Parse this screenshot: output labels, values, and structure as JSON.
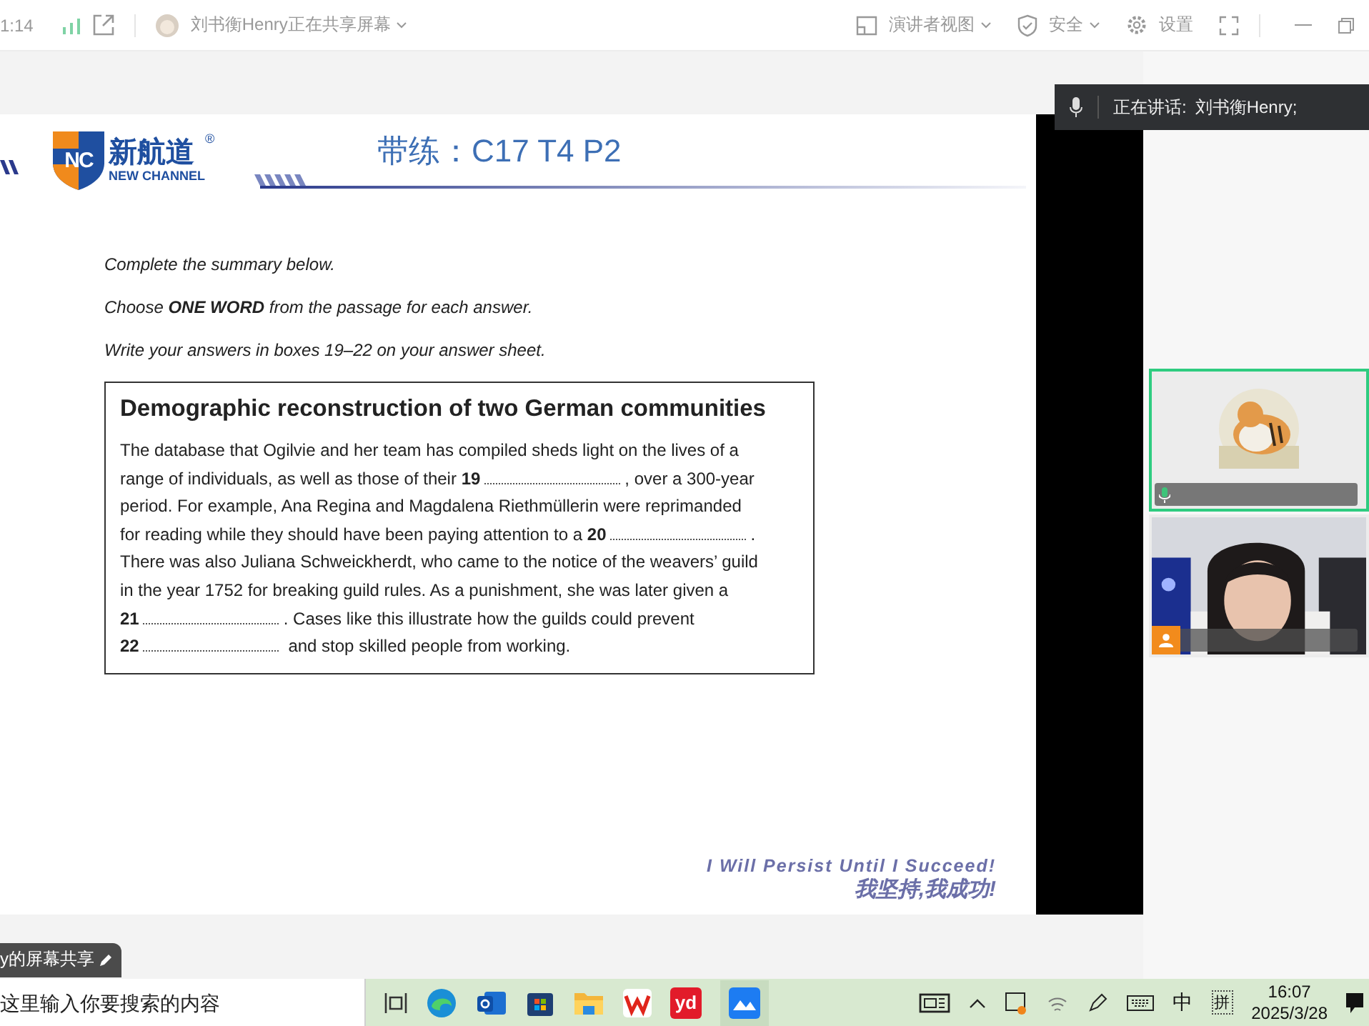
{
  "top_bar": {
    "time": "1:14",
    "sharer": "刘书衡Henry正在共享屏幕",
    "presenter_view": "演讲者视图",
    "security": "安全",
    "settings": "设置"
  },
  "slide": {
    "logo": {
      "mark": "NC",
      "name": "新航道",
      "registered": "®",
      "english": "NEW CHANNEL"
    },
    "title": "带练：C17 T4 P2",
    "instructions": [
      "Complete the summary below.",
      "Choose **ONE WORD** from the passage for each answer.",
      "Write your answers in boxes 19–22 on your answer sheet."
    ],
    "summary": {
      "heading": "Demographic reconstruction of two German communities",
      "lines": [
        [
          {
            "kind": "text",
            "text": "The database that Ogilvie and her team has compiled sheds light on the lives of a"
          }
        ],
        [
          {
            "kind": "text",
            "text": "range of individuals, as well as those of their "
          },
          {
            "kind": "blank",
            "text": "19"
          },
          {
            "kind": "text",
            "text": ", over a 300-year"
          }
        ],
        [
          {
            "kind": "text",
            "text": "period. For example, Ana Regina and Magdalena Riethmüllerin were reprimanded"
          }
        ],
        [
          {
            "kind": "text",
            "text": "for reading while they should have been paying attention to a "
          },
          {
            "kind": "blank",
            "text": "20"
          },
          {
            "kind": "text",
            "text": "."
          }
        ],
        [
          {
            "kind": "text",
            "text": "There was also Juliana Schweickherdt, who came to the notice of the weavers’ guild"
          }
        ],
        [
          {
            "kind": "text",
            "text": "in the year 1752 for breaking guild rules. As a punishment, she was later given a"
          }
        ],
        [
          {
            "kind": "blank",
            "text": "21"
          },
          {
            "kind": "text",
            "text": ". Cases like this illustrate how the guilds could prevent"
          }
        ],
        [
          {
            "kind": "blank",
            "text": "22"
          },
          {
            "kind": "text",
            "text": " and stop skilled people from working."
          }
        ]
      ]
    },
    "motto_english": "I Will Persist Until I Succeed!",
    "motto_chinese": "我坚持,我成功!"
  },
  "speaking_banner": {
    "label": "正在讲话:",
    "name": "刘书衡Henry;"
  },
  "participants": [
    {
      "kind": "avatar",
      "speaking": true
    },
    {
      "kind": "camera",
      "speaking": false
    }
  ],
  "share_tag": "y的屏幕共享",
  "taskbar": {
    "search_placeholder": "这里输入你要搜索的内容",
    "app_label": "yd",
    "ime": "中",
    "ime_mode": "拼",
    "time": "16:07",
    "date": "2025/3/28"
  }
}
